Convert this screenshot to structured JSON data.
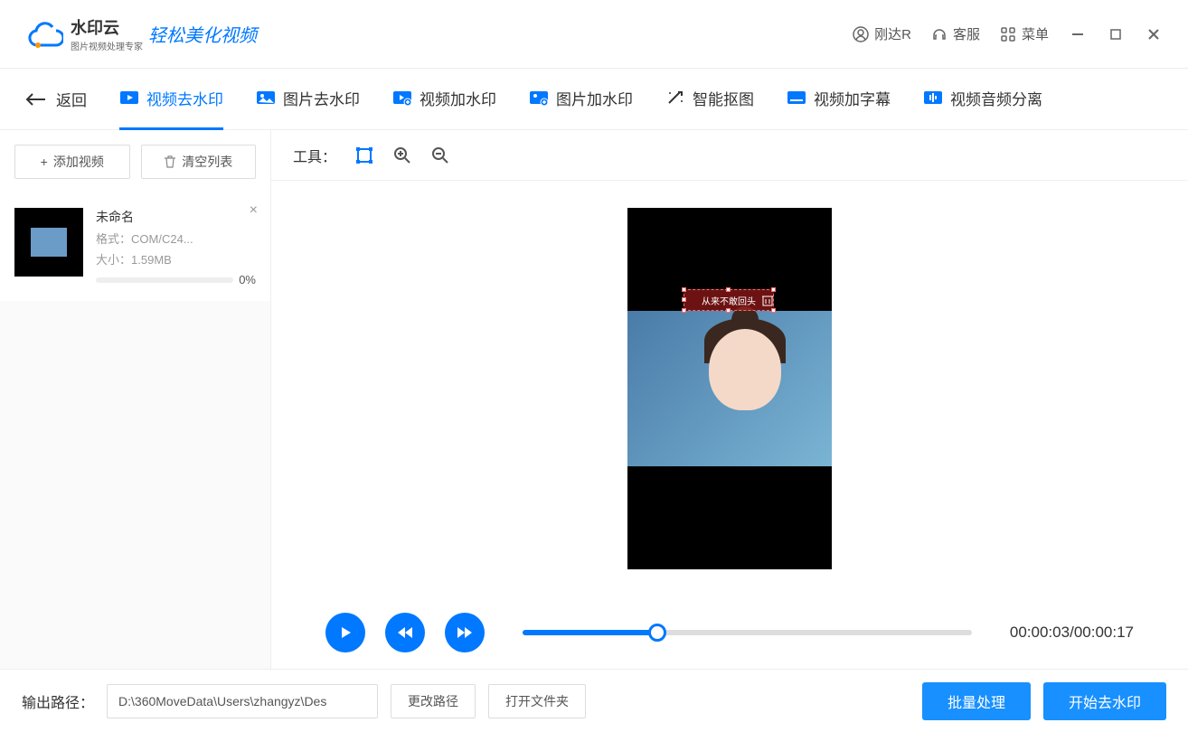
{
  "header": {
    "app_name": "水印云",
    "app_sub": "图片视频处理专家",
    "slogan": "轻松美化视频",
    "user": "刚达R",
    "support": "客服",
    "menu": "菜单"
  },
  "tabs": {
    "back": "返回",
    "items": [
      {
        "label": "视频去水印",
        "active": true
      },
      {
        "label": "图片去水印",
        "active": false
      },
      {
        "label": "视频加水印",
        "active": false
      },
      {
        "label": "图片加水印",
        "active": false
      },
      {
        "label": "智能抠图",
        "active": false
      },
      {
        "label": "视频加字幕",
        "active": false
      },
      {
        "label": "视频音频分离",
        "active": false
      }
    ]
  },
  "sidebar": {
    "add_video": "添加视频",
    "clear_list": "清空列表",
    "files": [
      {
        "name": "未命名",
        "format_label": "格式：",
        "format": "COM/C24...",
        "size_label": "大小：",
        "size": "1.59MB",
        "progress": "0%"
      }
    ]
  },
  "editor": {
    "tools_label": "工具：",
    "selection_text": "从来不敢回头"
  },
  "playback": {
    "current": "00:00:03",
    "total": "00:00:17",
    "progress_pct": 30
  },
  "footer": {
    "output_label": "输出路径：",
    "output_path": "D:\\360MoveData\\Users\\zhangyz\\Des",
    "change_path": "更改路径",
    "open_folder": "打开文件夹",
    "batch": "批量处理",
    "start": "开始去水印"
  }
}
